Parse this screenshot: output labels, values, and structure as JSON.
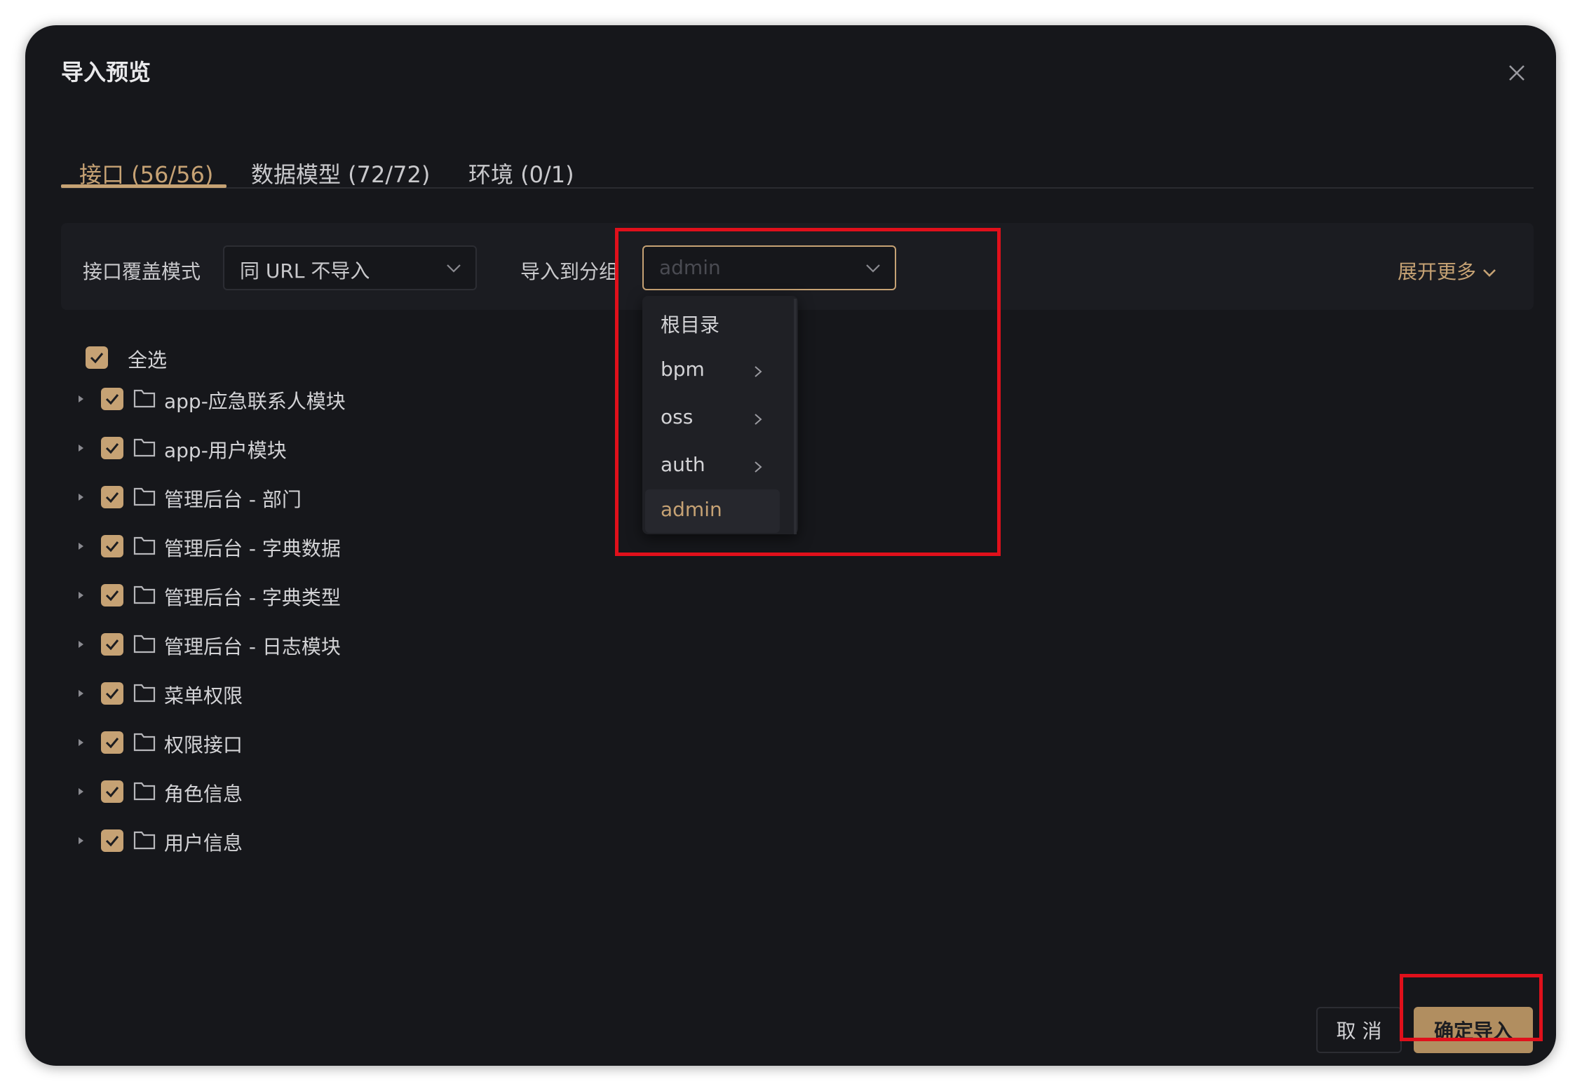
{
  "dialog": {
    "title": "导入预览",
    "close_icon": "close-icon"
  },
  "tabs": [
    {
      "label": "接口 (56/56)",
      "active": true
    },
    {
      "label": "数据模型 (72/72)",
      "active": false
    },
    {
      "label": "环境 (0/1)",
      "active": false
    }
  ],
  "filters": {
    "override_mode_label": "接口覆盖模式",
    "override_mode_value": "同 URL 不导入",
    "import_group_label": "导入到分组",
    "import_group_value": "admin",
    "expand_more": "展开更多"
  },
  "group_dropdown": {
    "items": [
      {
        "label": "根目录",
        "has_children": false,
        "selected": false
      },
      {
        "label": "bpm",
        "has_children": true,
        "selected": false
      },
      {
        "label": "oss",
        "has_children": true,
        "selected": false
      },
      {
        "label": "auth",
        "has_children": true,
        "selected": false
      },
      {
        "label": "admin",
        "has_children": false,
        "selected": true
      }
    ]
  },
  "tree": {
    "select_all_label": "全选",
    "select_all_checked": true,
    "folders": [
      {
        "label": "app-应急联系人模块",
        "checked": true
      },
      {
        "label": "app-用户模块",
        "checked": true
      },
      {
        "label": "管理后台 - 部门",
        "checked": true
      },
      {
        "label": "管理后台 - 字典数据",
        "checked": true
      },
      {
        "label": "管理后台 - 字典类型",
        "checked": true
      },
      {
        "label": "管理后台 - 日志模块",
        "checked": true
      },
      {
        "label": "菜单权限",
        "checked": true
      },
      {
        "label": "权限接口",
        "checked": true
      },
      {
        "label": "角色信息",
        "checked": true
      },
      {
        "label": "用户信息",
        "checked": true
      }
    ]
  },
  "footer": {
    "cancel_label": "取 消",
    "confirm_label": "确定导入"
  },
  "colors": {
    "accent": "#c6a274",
    "background": "#16171b",
    "highlight": "#e0101b"
  }
}
